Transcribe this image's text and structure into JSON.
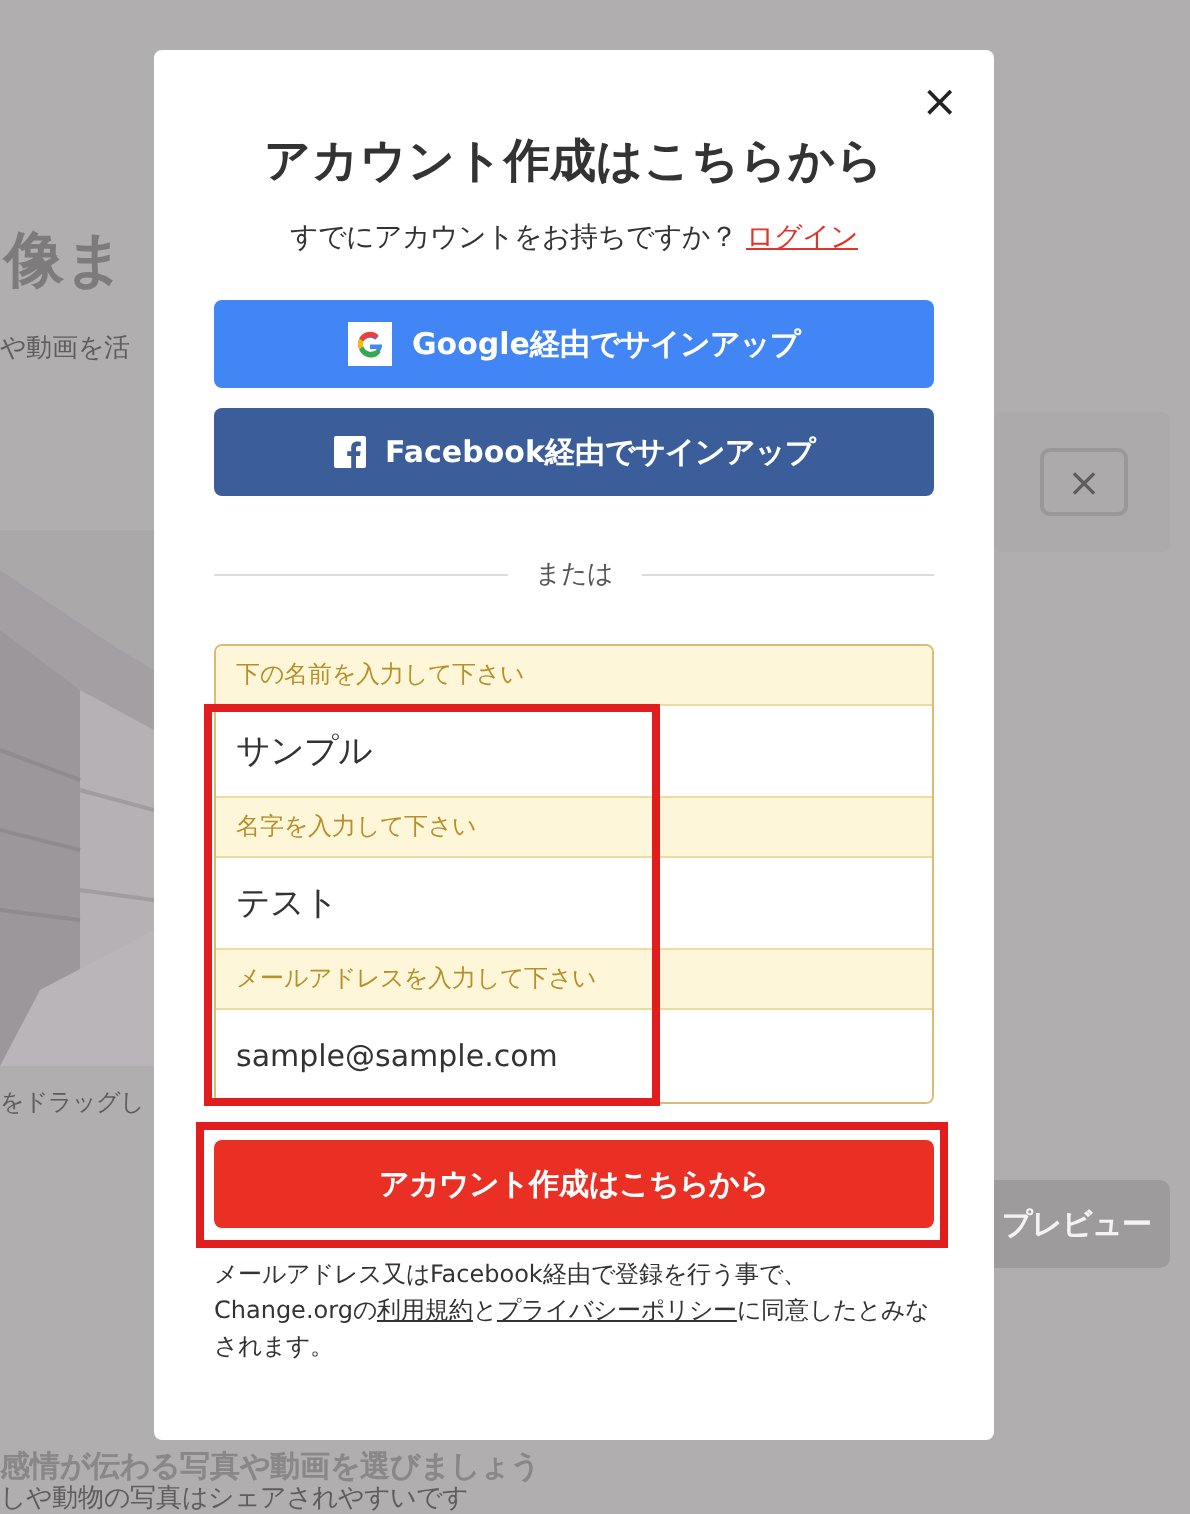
{
  "background": {
    "heading": "像ま",
    "subtitle": "や動画を活",
    "drag_hint": "をドラッグし",
    "close_box": "×",
    "preview_button": "プレビュー",
    "section_title": "感情が伝わる写真や動画を選びましょう",
    "section_text": "しや動物の写真はシェアされやすいです"
  },
  "modal": {
    "close": "×",
    "title": "アカウント作成はこちらから",
    "login_prompt": "すでにアカウントをお持ちですか？",
    "login_link": "ログイン",
    "social_buttons": [
      {
        "kind": "google",
        "label": "Google経由でサインアップ"
      },
      {
        "kind": "facebook",
        "label": "Facebook経由でサインアップ"
      }
    ],
    "divider_label": "または",
    "fields": [
      {
        "label": "下の名前を入力して下さい",
        "value": "サンプル"
      },
      {
        "label": "名字を入力して下さい",
        "value": "テスト"
      },
      {
        "label": "メールアドレスを入力して下さい",
        "value": "sample@sample.com"
      }
    ],
    "fields_highlighted": true,
    "submit": {
      "label": "アカウント作成はこちらから",
      "highlighted": true
    },
    "terms": [
      {
        "text": "メールアドレス又はFacebook経由で登録を行う事で、Change.orgの",
        "link": false
      },
      {
        "text": "利用規約",
        "link": true
      },
      {
        "text": "と",
        "link": false
      },
      {
        "text": "プライバシーポリシー",
        "link": true
      },
      {
        "text": "に同意したとみなされます。",
        "link": false
      }
    ]
  }
}
